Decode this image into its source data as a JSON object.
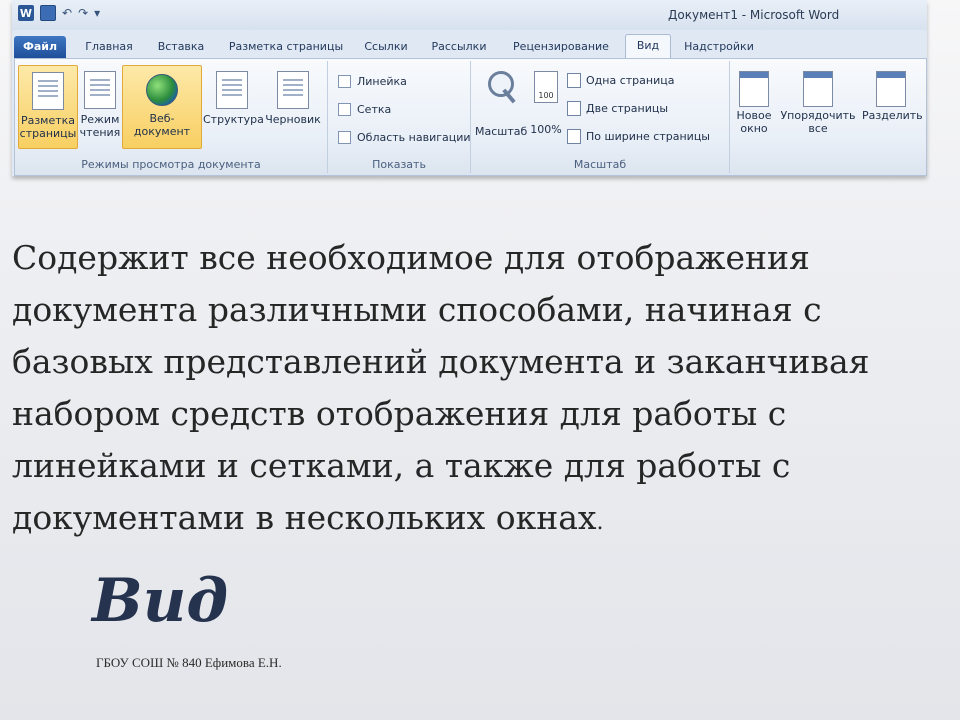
{
  "window": {
    "title": "Документ1 - Microsoft Word",
    "app_logo": "W",
    "qat": [
      "save-icon",
      "undo-icon",
      "repeat-icon",
      "customize-icon"
    ]
  },
  "tabs": [
    {
      "label": "Файл"
    },
    {
      "label": "Главная"
    },
    {
      "label": "Вставка"
    },
    {
      "label": "Разметка страницы"
    },
    {
      "label": "Ссылки"
    },
    {
      "label": "Рассылки"
    },
    {
      "label": "Рецензирование"
    },
    {
      "label": "Вид",
      "active": true
    },
    {
      "label": "Надстройки"
    }
  ],
  "ribbon": {
    "views_group": {
      "label": "Режимы просмотра документа",
      "buttons": [
        {
          "label": "Разметка страницы",
          "icon": "page-layout-icon",
          "selected": true
        },
        {
          "label": "Режим чтения",
          "icon": "reading-mode-icon"
        },
        {
          "label": "Веб-документ",
          "icon": "web-layout-icon"
        },
        {
          "label": "Структура",
          "icon": "outline-icon"
        },
        {
          "label": "Черновик",
          "icon": "draft-icon"
        }
      ]
    },
    "show_group": {
      "label": "Показать",
      "checkboxes": [
        {
          "label": "Линейка",
          "checked": false
        },
        {
          "label": "Сетка",
          "checked": false
        },
        {
          "label": "Область навигации",
          "checked": false
        }
      ]
    },
    "zoom_group": {
      "label": "Масштаб",
      "zoom": "Масштаб",
      "hundred": "100%",
      "hundred_icon_text": "100",
      "one_page": "Одна страница",
      "two_pages": "Две страницы",
      "page_width": "По ширине страницы"
    },
    "window_group": {
      "new_window": "Новое окно",
      "arrange_all": "Упорядочить все",
      "split": "Разделить"
    }
  },
  "slide": {
    "body": "Содержит все необходимое для отображения документа различными способами, начиная с базовых представлений документа и заканчивая набором средств отображения  для работы с линейками и сетками, а также для работы с документами в нескольких окнах",
    "body_end": ".",
    "title": "Вид",
    "footer": "ГБОУ СОШ № 840 Ефимова Е.Н."
  }
}
